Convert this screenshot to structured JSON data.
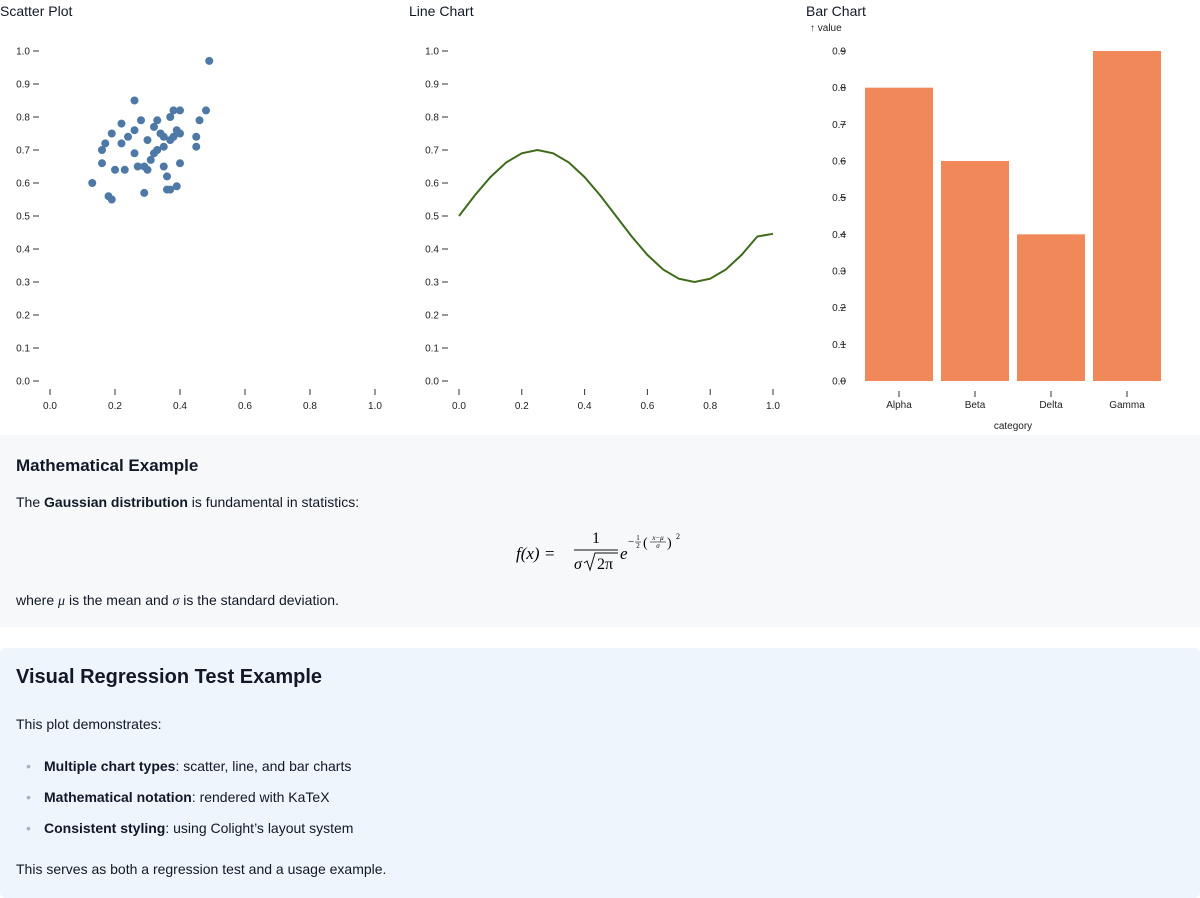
{
  "chart_data": [
    {
      "type": "scatter",
      "title": "Scatter Plot",
      "xlim": [
        0,
        1
      ],
      "ylim": [
        0,
        1
      ],
      "x_ticks": [
        "0.0",
        "0.2",
        "0.4",
        "0.6",
        "0.8",
        "1.0"
      ],
      "y_ticks": [
        "0.0",
        "0.1",
        "0.2",
        "0.3",
        "0.4",
        "0.5",
        "0.6",
        "0.7",
        "0.8",
        "0.9",
        "1.0"
      ],
      "color": "#4e79a7",
      "points": [
        [
          0.13,
          0.6
        ],
        [
          0.16,
          0.7
        ],
        [
          0.17,
          0.72
        ],
        [
          0.16,
          0.66
        ],
        [
          0.18,
          0.56
        ],
        [
          0.19,
          0.55
        ],
        [
          0.19,
          0.75
        ],
        [
          0.2,
          0.64
        ],
        [
          0.22,
          0.72
        ],
        [
          0.22,
          0.78
        ],
        [
          0.23,
          0.64
        ],
        [
          0.24,
          0.74
        ],
        [
          0.26,
          0.76
        ],
        [
          0.26,
          0.85
        ],
        [
          0.26,
          0.69
        ],
        [
          0.27,
          0.65
        ],
        [
          0.28,
          0.79
        ],
        [
          0.29,
          0.57
        ],
        [
          0.29,
          0.65
        ],
        [
          0.3,
          0.64
        ],
        [
          0.3,
          0.73
        ],
        [
          0.31,
          0.67
        ],
        [
          0.32,
          0.69
        ],
        [
          0.32,
          0.77
        ],
        [
          0.33,
          0.79
        ],
        [
          0.33,
          0.7
        ],
        [
          0.34,
          0.75
        ],
        [
          0.35,
          0.74
        ],
        [
          0.35,
          0.71
        ],
        [
          0.35,
          0.65
        ],
        [
          0.36,
          0.58
        ],
        [
          0.36,
          0.62
        ],
        [
          0.37,
          0.73
        ],
        [
          0.37,
          0.8
        ],
        [
          0.37,
          0.58
        ],
        [
          0.38,
          0.82
        ],
        [
          0.38,
          0.74
        ],
        [
          0.39,
          0.59
        ],
        [
          0.39,
          0.76
        ],
        [
          0.4,
          0.75
        ],
        [
          0.4,
          0.66
        ],
        [
          0.4,
          0.82
        ],
        [
          0.45,
          0.71
        ],
        [
          0.45,
          0.74
        ],
        [
          0.46,
          0.79
        ],
        [
          0.48,
          0.82
        ],
        [
          0.49,
          0.97
        ]
      ]
    },
    {
      "type": "line",
      "title": "Line Chart",
      "xlim": [
        0,
        1
      ],
      "ylim": [
        0,
        1
      ],
      "x_ticks": [
        "0.0",
        "0.2",
        "0.4",
        "0.6",
        "0.8",
        "1.0"
      ],
      "y_ticks": [
        "0.0",
        "0.1",
        "0.2",
        "0.3",
        "0.4",
        "0.5",
        "0.6",
        "0.7",
        "0.8",
        "0.9",
        "1.0"
      ],
      "color": "#3d6b1a",
      "x": [
        0.0,
        0.05,
        0.1,
        0.15,
        0.2,
        0.25,
        0.3,
        0.35,
        0.4,
        0.45,
        0.5,
        0.55,
        0.6,
        0.65,
        0.7,
        0.75,
        0.8,
        0.85,
        0.9,
        0.95,
        1.0
      ],
      "y": [
        0.5,
        0.562,
        0.618,
        0.662,
        0.69,
        0.7,
        0.69,
        0.662,
        0.618,
        0.562,
        0.5,
        0.438,
        0.382,
        0.338,
        0.31,
        0.3,
        0.31,
        0.338,
        0.382,
        0.438,
        0.446
      ]
    },
    {
      "type": "bar",
      "title": "Bar Chart",
      "ylabel": "↑ value",
      "xlabel": "category",
      "ylim": [
        0,
        0.9
      ],
      "y_ticks": [
        "0.0",
        "0.1",
        "0.2",
        "0.3",
        "0.4",
        "0.5",
        "0.6",
        "0.7",
        "0.8",
        "0.9"
      ],
      "color": "#f0885a",
      "categories": [
        "Alpha",
        "Beta",
        "Delta",
        "Gamma"
      ],
      "values": [
        0.8,
        0.6,
        0.4,
        0.9
      ]
    }
  ],
  "math": {
    "heading": "Mathematical Example",
    "intro_prefix": "The ",
    "intro_bold": "Gaussian distribution",
    "intro_suffix": " is fundamental in statistics:",
    "formula": {
      "lhs": "f(x) =",
      "numerator": "1",
      "denominator_sigma": "σ",
      "denominator_root": "2π",
      "base": "e",
      "exp_sign": "−",
      "exp_half_num": "1",
      "exp_half_den": "2",
      "exp_frac_num": "x−μ",
      "exp_frac_den": "σ",
      "exp_power": "2"
    },
    "outro_where": "where ",
    "outro_mu": "μ",
    "outro_mid": " is the mean and ",
    "outro_sigma": "σ",
    "outro_end": " is the standard deviation."
  },
  "regression": {
    "heading": "Visual Regression Test Example",
    "intro": "This plot demonstrates:",
    "bullet": "•",
    "items": [
      {
        "bold": "Multiple chart types",
        "text": ": scatter, line, and bar charts"
      },
      {
        "bold": "Mathematical notation",
        "text": ": rendered with KaTeX"
      },
      {
        "bold": "Consistent styling",
        "text": ": using Colight’s layout system"
      }
    ],
    "outro": "This serves as both a regression test and a usage example."
  }
}
